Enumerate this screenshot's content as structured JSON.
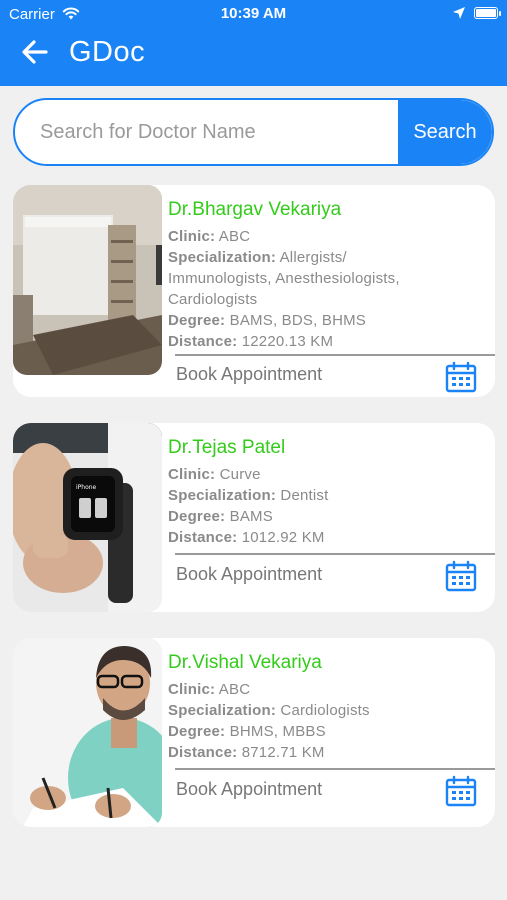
{
  "status": {
    "carrier": "Carrier",
    "time": "10:39 AM"
  },
  "header": {
    "title": "GDoc"
  },
  "search": {
    "placeholder": "Search for Doctor Name",
    "button_label": "Search"
  },
  "labels": {
    "clinic": "Clinic:",
    "specialization": "Specialization:",
    "degree": "Degree:",
    "distance": "Distance:",
    "book": "Book Appointment"
  },
  "doctors": [
    {
      "name": "Dr.Bhargav Vekariya",
      "clinic": "ABC",
      "specialization_lines": [
        "Allergists/",
        "Immunologists, Anesthesiologists,",
        "Cardiologists"
      ],
      "degree": "BAMS, BDS, BHMS",
      "distance": "12220.13 KM"
    },
    {
      "name": "Dr.Tejas Patel",
      "clinic": "Curve",
      "specialization": "Dentist",
      "degree": "BAMS",
      "distance": "1012.92 KM"
    },
    {
      "name": "Dr.Vishal Vekariya",
      "clinic": "ABC",
      "specialization": "Cardiologists",
      "degree": "BHMS, MBBS",
      "distance": "8712.71 KM"
    }
  ],
  "colors": {
    "brand": "#1a84f7",
    "doctor_name": "#33cc1a"
  }
}
